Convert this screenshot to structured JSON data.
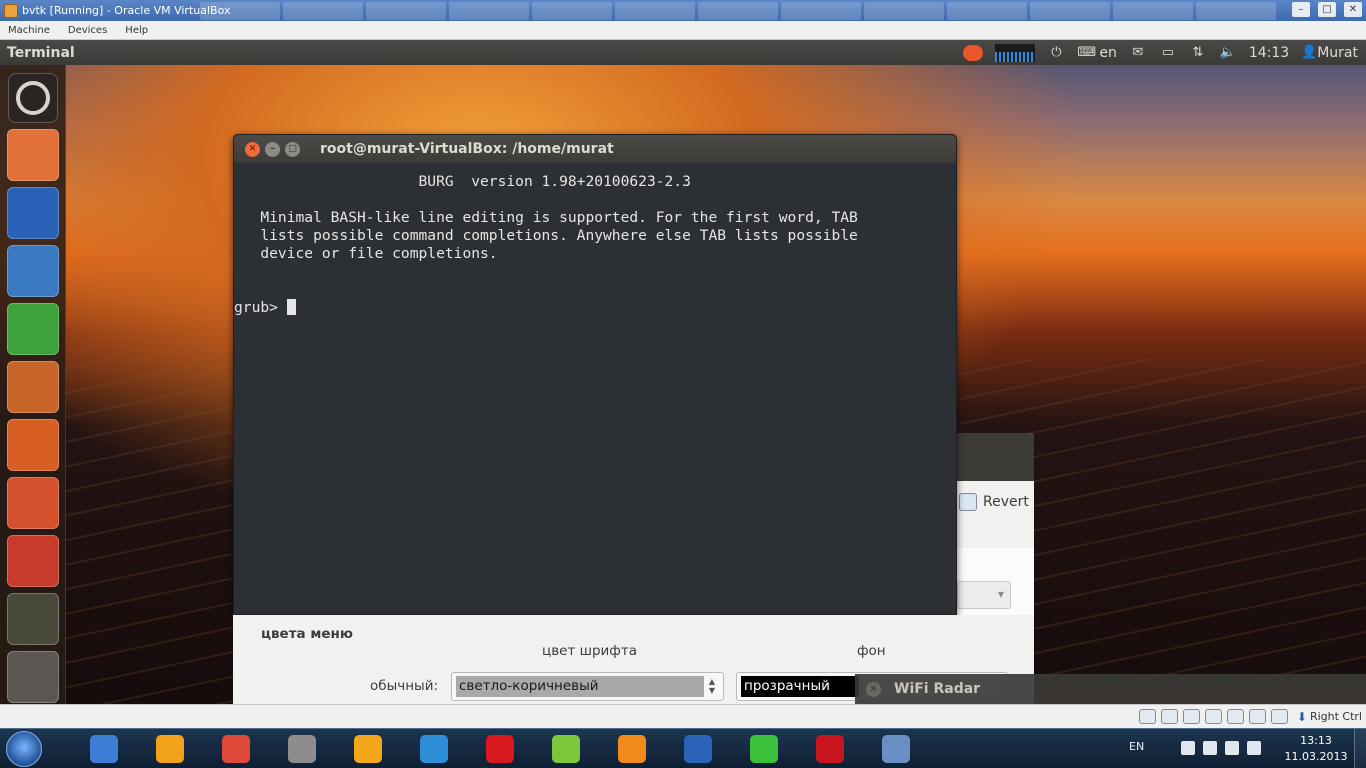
{
  "host_window": {
    "title": "bvtk [Running] - Oracle VM VirtualBox",
    "menu": [
      "Machine",
      "Devices",
      "Help"
    ]
  },
  "ubuntu_panel": {
    "app_title": "Terminal",
    "keyboard_layout": "en",
    "time": "14:13",
    "user": "Murat"
  },
  "launcher": {
    "items": [
      {
        "name": "dash-home",
        "icon": "ubuntu-logo-icon",
        "color": "#2a2522"
      },
      {
        "name": "home-folder",
        "icon": "folder-icon",
        "color": "#e2703a"
      },
      {
        "name": "firefox",
        "icon": "firefox-icon",
        "color": "#2a62b8"
      },
      {
        "name": "libreoffice-writer",
        "icon": "writer-icon",
        "color": "#3a7ac2"
      },
      {
        "name": "libreoffice-calc",
        "icon": "calc-icon",
        "color": "#3ea23a"
      },
      {
        "name": "libreoffice-impress",
        "icon": "impress-icon",
        "color": "#c8662a"
      },
      {
        "name": "ubuntu-software-center",
        "icon": "software-center-icon",
        "color": "#d85f24"
      },
      {
        "name": "ubuntu-one",
        "icon": "ubuntu-one-icon",
        "color": "#d4502a"
      },
      {
        "name": "system-settings",
        "icon": "settings-icon",
        "color": "#c83a2a"
      },
      {
        "name": "game",
        "icon": "game-character-icon",
        "color": "#4a4a3a"
      },
      {
        "name": "trash",
        "icon": "trash-icon",
        "color": "#5a5652"
      }
    ]
  },
  "terminal": {
    "title": "root@murat-VirtualBox: /home/murat",
    "lines": [
      "                     BURG  version 1.98+20100623-2.3",
      "",
      "   Minimal BASH-like line editing is supported. For the first word, TAB",
      "   lists possible command completions. Anywhere else TAB lists possible",
      "   device or file completions.",
      "",
      ""
    ],
    "prompt": "grub> "
  },
  "settings_dialog": {
    "revert_label": "Revert",
    "section_title": "цвета меню",
    "col_font": "цвет шрифта",
    "col_bg": "фон",
    "row_label": "обычный:",
    "font_color_value": "светло-коричневый",
    "bg_color_value": "прозрачный"
  },
  "notification": {
    "title": "WiFi Radar"
  },
  "vb_status": {
    "host_key": "Right Ctrl"
  },
  "taskbar": {
    "pinned": [
      {
        "name": "windows-media-player",
        "color": "#3d7fd6"
      },
      {
        "name": "aimp",
        "color": "#f1a21a"
      },
      {
        "name": "chrome",
        "color": "#e04a3a"
      },
      {
        "name": "total-commander",
        "color": "#8d8d8d"
      },
      {
        "name": "qip",
        "color": "#f2a81a"
      },
      {
        "name": "mail-agent",
        "color": "#2f8ed8"
      },
      {
        "name": "opera",
        "color": "#d8191f"
      },
      {
        "name": "vuze",
        "color": "#7dc83a"
      },
      {
        "name": "odnoklassniki",
        "color": "#f28a1a"
      },
      {
        "name": "word",
        "color": "#2a63b8"
      },
      {
        "name": "green-app",
        "color": "#3bc23a"
      },
      {
        "name": "adobe-reader",
        "color": "#c8141c"
      },
      {
        "name": "virtualbox",
        "color": "#6b8fc4"
      }
    ],
    "lang": "EN",
    "time": "13:13",
    "date": "11.03.2013"
  }
}
